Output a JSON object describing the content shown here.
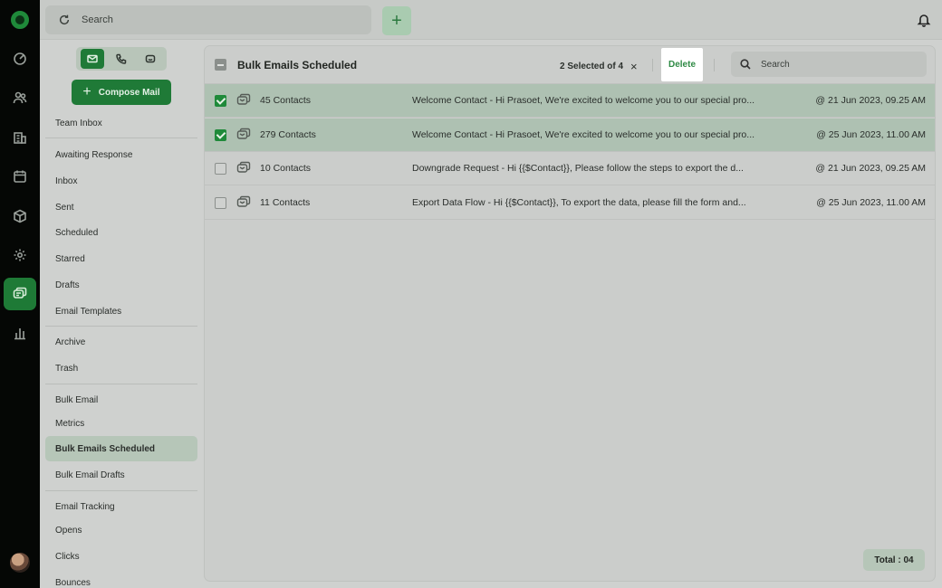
{
  "topbar": {
    "search_placeholder": "Search",
    "add_label": "+"
  },
  "sidebar": {
    "compose_label": "Compose Mail",
    "items": [
      {
        "label": "Team Inbox"
      },
      {
        "label": "Awaiting Response"
      },
      {
        "label": "Inbox"
      },
      {
        "label": "Sent"
      },
      {
        "label": "Scheduled"
      },
      {
        "label": "Starred"
      },
      {
        "label": "Drafts"
      },
      {
        "label": "Email Templates"
      },
      {
        "label": "Archive"
      },
      {
        "label": "Trash"
      },
      {
        "label": "Bulk Email"
      },
      {
        "label": "Metrics"
      },
      {
        "label": "Bulk Emails Scheduled"
      },
      {
        "label": "Bulk Email Drafts"
      },
      {
        "label": "Email Tracking"
      },
      {
        "label": "Opens"
      },
      {
        "label": "Clicks"
      },
      {
        "label": "Bounces"
      }
    ],
    "active": "Bulk Emails Scheduled"
  },
  "panel": {
    "title": "Bulk Emails Scheduled",
    "selection_text": "2 Selected of 4",
    "clear_label": "×",
    "delete_label": "Delete",
    "search_placeholder": "Search",
    "rows": [
      {
        "contacts": "45 Contacts",
        "subject": "Welcome Contact  -  Hi Prasoet, We're excited to welcome you to our special pro...",
        "date": "@ 21 Jun 2023, 09.25 AM",
        "selected": true
      },
      {
        "contacts": "279 Contacts",
        "subject": "Welcome Contact  -  Hi Prasoet, We're excited to welcome you to our special pro...",
        "date": "@ 25 Jun 2023, 11.00 AM",
        "selected": true
      },
      {
        "contacts": "10 Contacts",
        "subject": "Downgrade Request  -  Hi {{$Contact}}, Please follow the steps to export the  d...",
        "date": "@ 21 Jun 2023, 09.25 AM",
        "selected": false
      },
      {
        "contacts": "11 Contacts",
        "subject": "Export Data Flow  -  Hi {{$Contact}}, To export the data, please fill the form and...",
        "date": "@ 25 Jun 2023, 11.00 AM",
        "selected": false
      }
    ],
    "total_label": "Total : 04"
  },
  "colors": {
    "brand": "#1f7a37",
    "selected_row": "#aec1b2",
    "delete_text": "#2f8a45"
  }
}
